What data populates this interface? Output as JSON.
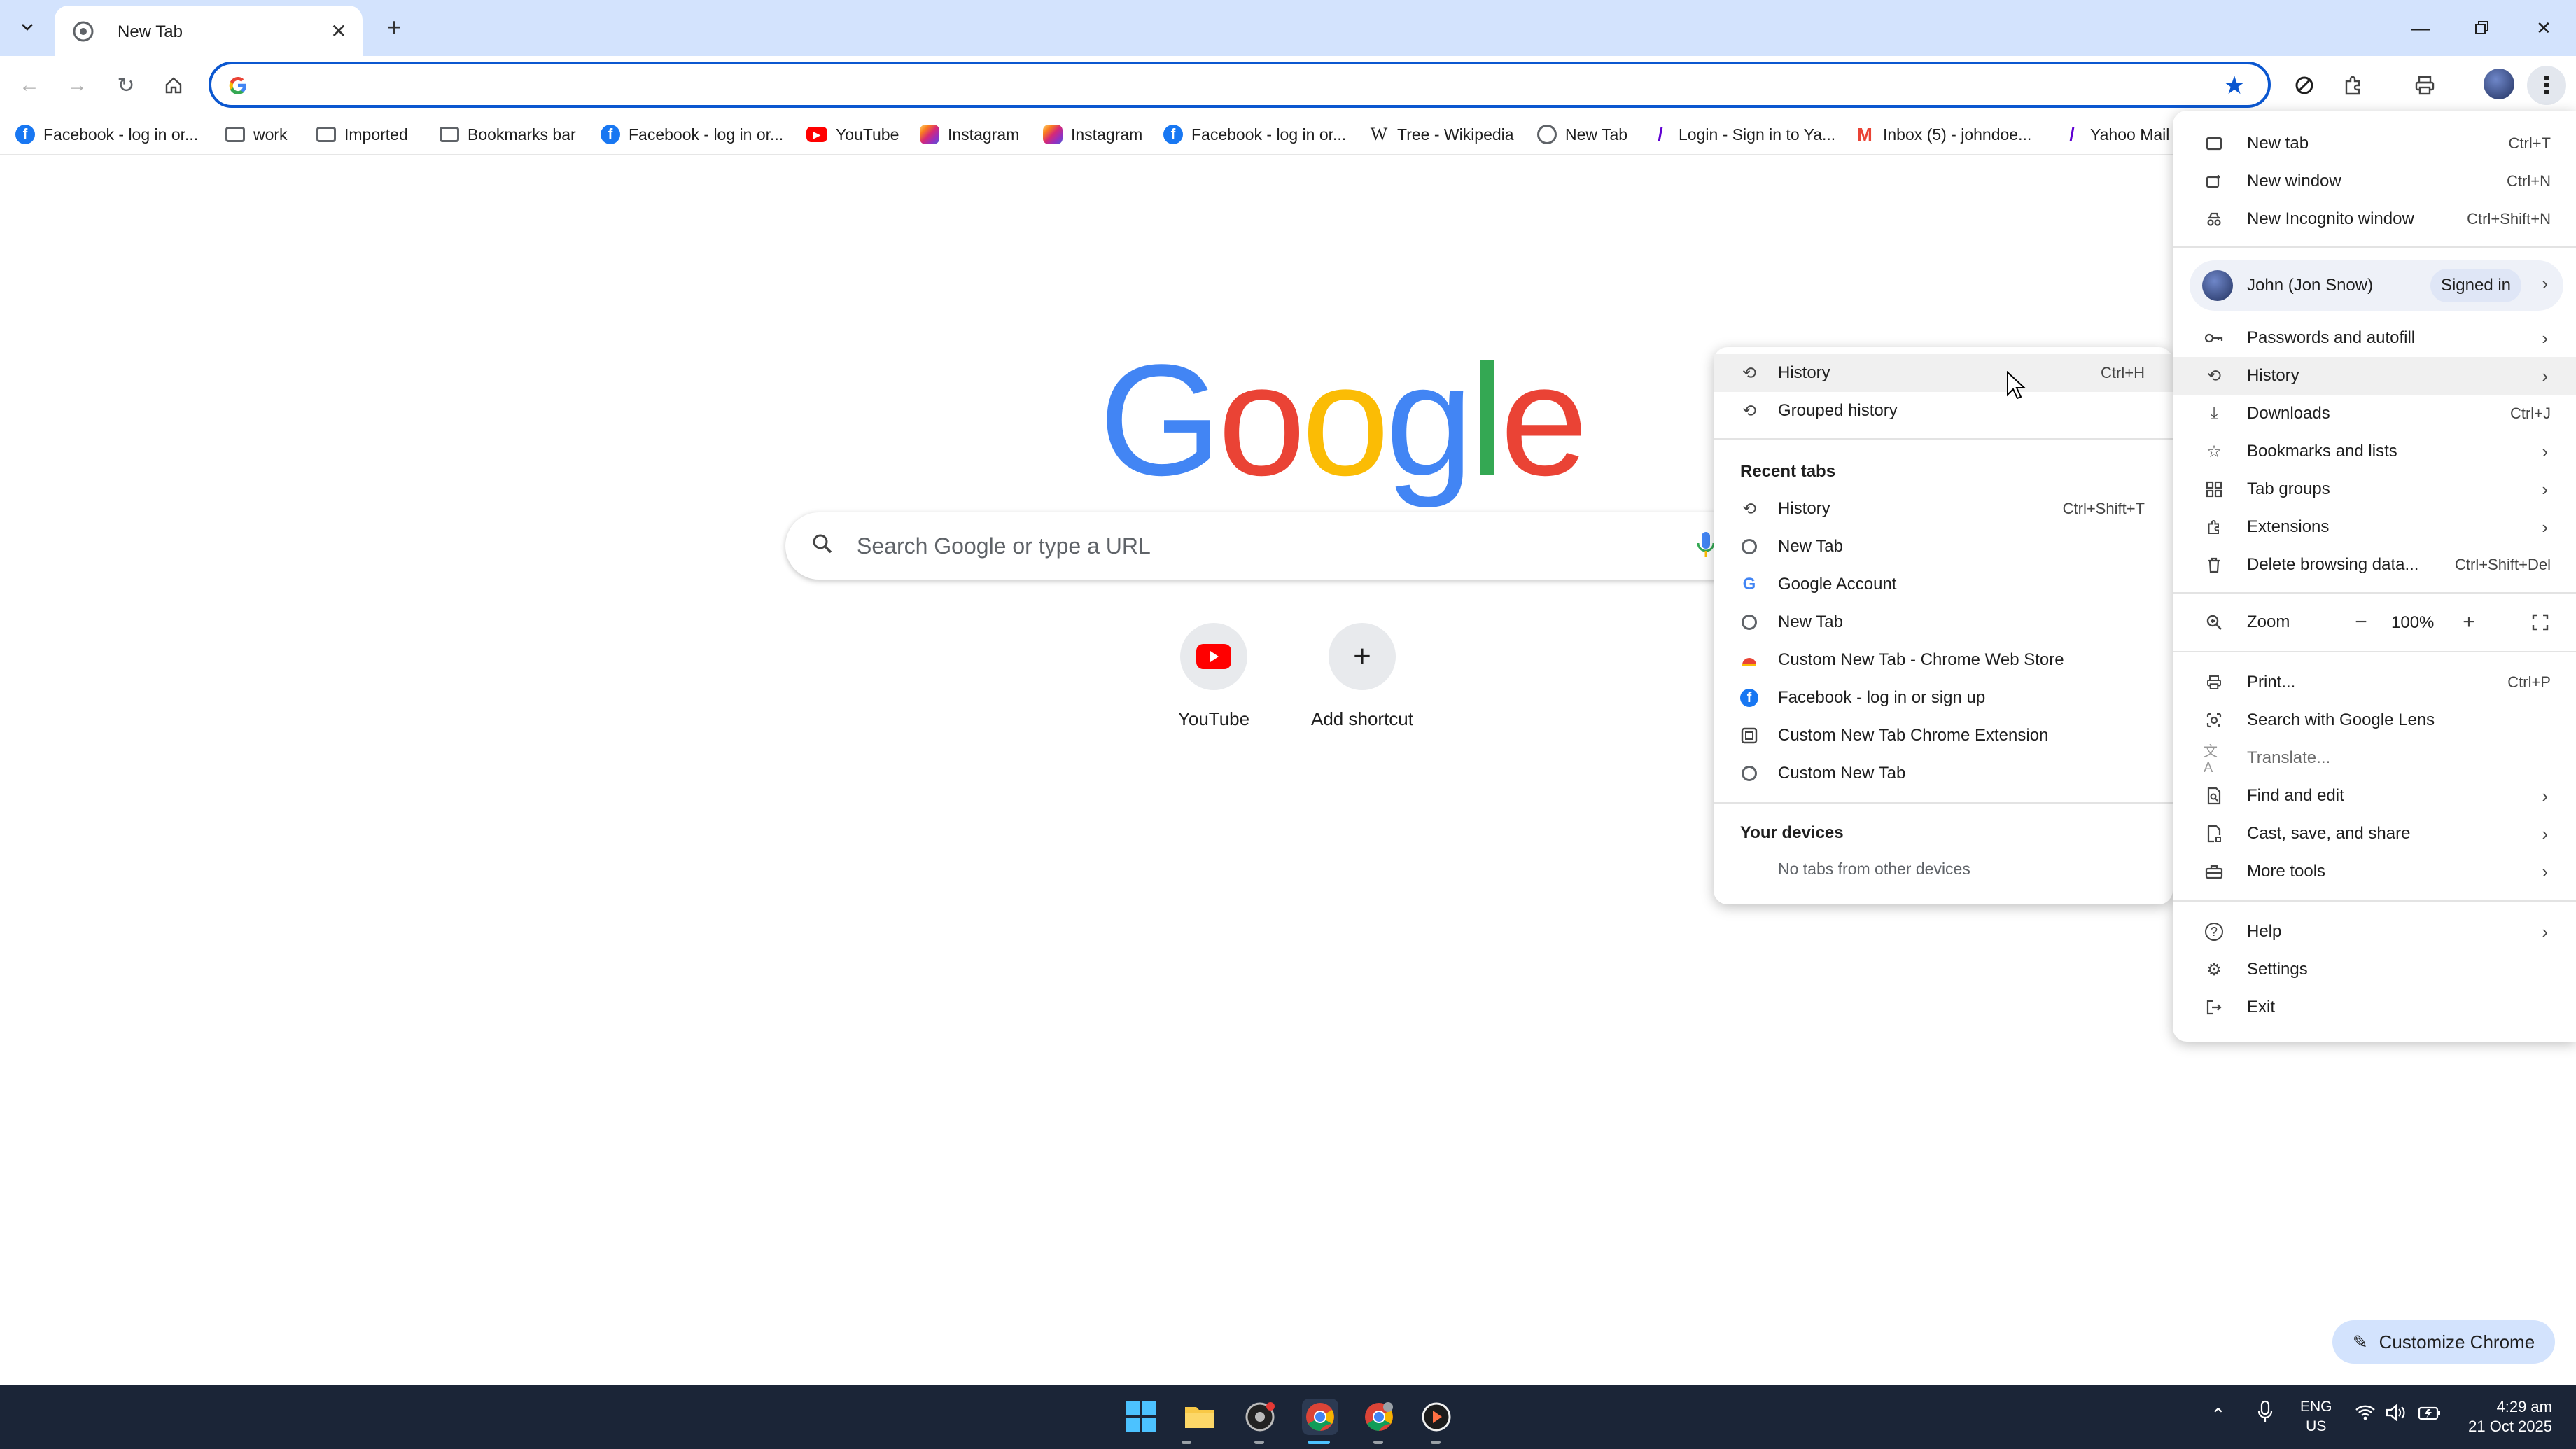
{
  "browser": {
    "tab": {
      "title": "New Tab"
    },
    "omnibox": {
      "value": ""
    },
    "bookmarks": [
      {
        "label": "Facebook - log in or...",
        "icon": "facebook-icon"
      },
      {
        "label": "work",
        "icon": "folder-icon"
      },
      {
        "label": "Imported",
        "icon": "folder-icon"
      },
      {
        "label": "Bookmarks bar",
        "icon": "folder-icon"
      },
      {
        "label": "Facebook - log in or...",
        "icon": "facebook-icon"
      },
      {
        "label": "YouTube",
        "icon": "youtube-icon"
      },
      {
        "label": "Instagram",
        "icon": "instagram-icon"
      },
      {
        "label": "Instagram",
        "icon": "instagram-icon"
      },
      {
        "label": "Facebook - log in or...",
        "icon": "facebook-icon"
      },
      {
        "label": "Tree - Wikipedia",
        "icon": "wikipedia-icon"
      },
      {
        "label": "New Tab",
        "icon": "globe-icon"
      },
      {
        "label": "Login - Sign in to Ya...",
        "icon": "yahoo-icon"
      },
      {
        "label": "Inbox (5) - johndoe...",
        "icon": "gmail-icon"
      },
      {
        "label": "Yahoo Mail",
        "icon": "yahoo-icon"
      }
    ]
  },
  "newtab": {
    "logo_letters": [
      "G",
      "o",
      "o",
      "g",
      "l",
      "e"
    ],
    "logo_colors": [
      "#4285F4",
      "#EA4335",
      "#FBBC05",
      "#4285F4",
      "#34A853",
      "#EA4335"
    ],
    "search_placeholder": "Search Google or type a URL",
    "shortcuts": [
      {
        "label": "YouTube",
        "icon": "youtube-icon"
      },
      {
        "label": "Add shortcut",
        "icon": "plus-icon"
      }
    ],
    "customize_label": "Customize Chrome"
  },
  "history_submenu": {
    "items": [
      {
        "label": "History",
        "shortcut": "Ctrl+H",
        "icon": "history-icon"
      },
      {
        "label": "Grouped history",
        "icon": "history-icon"
      }
    ],
    "recent_tabs_heading": "Recent tabs",
    "recent_tabs": [
      {
        "label": "History",
        "shortcut": "Ctrl+Shift+T",
        "icon": "history-icon"
      },
      {
        "label": "New Tab",
        "icon": "globe-icon"
      },
      {
        "label": "Google Account",
        "icon": "google-icon"
      },
      {
        "label": "New Tab",
        "icon": "globe-icon"
      },
      {
        "label": "Custom New Tab - Chrome Web Store",
        "icon": "web-store-icon"
      },
      {
        "label": "Facebook - log in or sign up",
        "icon": "facebook-icon"
      },
      {
        "label": "Custom New Tab Chrome Extension",
        "icon": "extension-page-icon"
      },
      {
        "label": "Custom New Tab",
        "icon": "globe-icon"
      }
    ],
    "devices_heading": "Your devices",
    "devices_empty": "No tabs from other devices"
  },
  "main_menu": {
    "top": [
      {
        "label": "New tab",
        "shortcut": "Ctrl+T"
      },
      {
        "label": "New window",
        "shortcut": "Ctrl+N"
      },
      {
        "label": "New Incognito window",
        "shortcut": "Ctrl+Shift+N"
      }
    ],
    "profile": {
      "name": "John (Jon Snow)",
      "status": "Signed in"
    },
    "mid": [
      {
        "label": "Passwords and autofill",
        "shortcut": "",
        "arrow": true
      },
      {
        "label": "History",
        "shortcut": "",
        "arrow": true
      },
      {
        "label": "Downloads",
        "shortcut": "Ctrl+J",
        "arrow": false
      },
      {
        "label": "Bookmarks and lists",
        "shortcut": "",
        "arrow": true
      },
      {
        "label": "Tab groups",
        "shortcut": "",
        "arrow": true
      },
      {
        "label": "Extensions",
        "shortcut": "",
        "arrow": true
      },
      {
        "label": "Delete browsing data...",
        "shortcut": "Ctrl+Shift+Del",
        "arrow": false
      }
    ],
    "zoom": {
      "label": "Zoom",
      "value": "100%",
      "minus": "−",
      "plus": "+"
    },
    "tools": [
      {
        "label": "Print...",
        "shortcut": "Ctrl+P",
        "arrow": false
      },
      {
        "label": "Search with Google Lens",
        "shortcut": "",
        "arrow": false
      },
      {
        "label": "Translate...",
        "shortcut": "",
        "arrow": false
      },
      {
        "label": "Find and edit",
        "shortcut": "",
        "arrow": true
      },
      {
        "label": "Cast, save, and share",
        "shortcut": "",
        "arrow": true
      },
      {
        "label": "More tools",
        "shortcut": "",
        "arrow": true
      }
    ],
    "bottom": [
      {
        "label": "Help",
        "arrow": true
      },
      {
        "label": "Settings",
        "arrow": false
      },
      {
        "label": "Exit",
        "arrow": false
      }
    ]
  },
  "taskbar": {
    "lang_top": "ENG",
    "lang_bottom": "US",
    "time": "4:29 am",
    "date": "21 Oct 2025"
  }
}
